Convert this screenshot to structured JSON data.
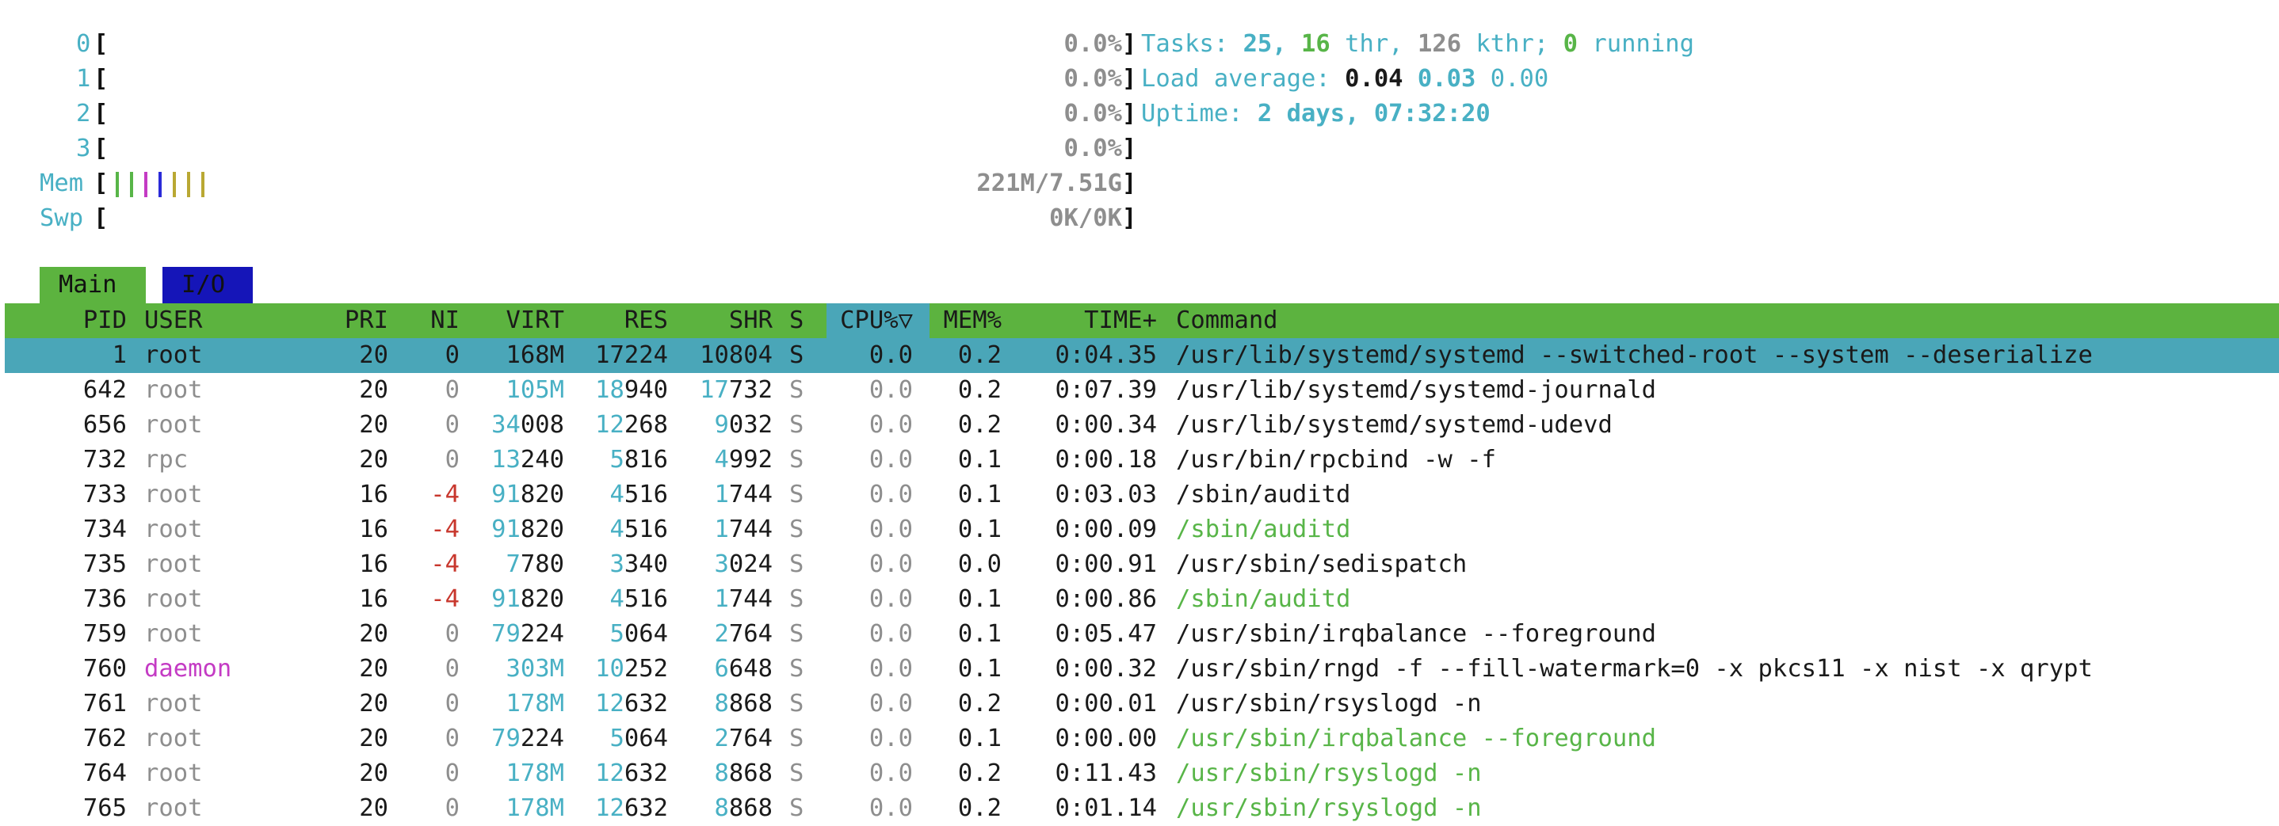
{
  "cpu_meters": [
    {
      "label": "0",
      "value": "0.0%"
    },
    {
      "label": "1",
      "value": "0.0%"
    },
    {
      "label": "2",
      "value": "0.0%"
    },
    {
      "label": "3",
      "value": "0.0%"
    }
  ],
  "mem": {
    "label": "Mem",
    "value": "221M/7.51G",
    "bar_colors": [
      "#58b548",
      "#58b548",
      "#c43bc4",
      "#2a2ad8",
      "#b9a833",
      "#b9a833",
      "#b9a833"
    ]
  },
  "swp": {
    "label": "Swp",
    "value": "0K/0K"
  },
  "summary": {
    "tasks_label": "Tasks:",
    "tasks": "25,",
    "thr": "16",
    "thr_label": "thr,",
    "kthr": "126",
    "kthr_label": "kthr;",
    "running": "0",
    "running_label": "running",
    "load_label": "Load average:",
    "load1": "0.04",
    "load5": "0.03",
    "load15": "0.00",
    "uptime_label": "Uptime:",
    "uptime": "2 days, 07:32:20"
  },
  "tabs": {
    "main": "Main",
    "io": "I/O"
  },
  "columns": {
    "pid": "PID",
    "user": "USER",
    "pri": "PRI",
    "ni": "NI",
    "virt": "VIRT",
    "res": "RES",
    "shr": "SHR",
    "s": "S",
    "cpu": "CPU%▽",
    "mem": "MEM%",
    "time": "TIME+",
    "command": "Command"
  },
  "processes": [
    {
      "pid": "1",
      "user": "root",
      "pri": "20",
      "ni": "0",
      "virt": "168M",
      "res": "17224",
      "shr": "10804",
      "s": "S",
      "cpu": "0.0",
      "mem": "0.2",
      "time": "0:04.35",
      "command": "/usr/lib/systemd/systemd --switched-root --system --deserialize",
      "selected": true
    },
    {
      "pid": "642",
      "user": "root",
      "pri": "20",
      "ni": "0",
      "virt": "105M",
      "res": "18940",
      "shr": "17732",
      "s": "S",
      "cpu": "0.0",
      "mem": "0.2",
      "time": "0:07.39",
      "command": "/usr/lib/systemd/systemd-journald"
    },
    {
      "pid": "656",
      "user": "root",
      "pri": "20",
      "ni": "0",
      "virt": "34008",
      "res": "12268",
      "shr": "9032",
      "s": "S",
      "cpu": "0.0",
      "mem": "0.2",
      "time": "0:00.34",
      "command": "/usr/lib/systemd/systemd-udevd"
    },
    {
      "pid": "732",
      "user": "rpc",
      "pri": "20",
      "ni": "0",
      "virt": "13240",
      "res": "5816",
      "shr": "4992",
      "s": "S",
      "cpu": "0.0",
      "mem": "0.1",
      "time": "0:00.18",
      "command": "/usr/bin/rpcbind -w -f"
    },
    {
      "pid": "733",
      "user": "root",
      "pri": "16",
      "ni": "-4",
      "virt": "91820",
      "res": "4516",
      "shr": "1744",
      "s": "S",
      "cpu": "0.0",
      "mem": "0.1",
      "time": "0:03.03",
      "command": "/sbin/auditd"
    },
    {
      "pid": "734",
      "user": "root",
      "pri": "16",
      "ni": "-4",
      "virt": "91820",
      "res": "4516",
      "shr": "1744",
      "s": "S",
      "cpu": "0.0",
      "mem": "0.1",
      "time": "0:00.09",
      "command": "/sbin/auditd",
      "thread": true
    },
    {
      "pid": "735",
      "user": "root",
      "pri": "16",
      "ni": "-4",
      "virt": "7780",
      "res": "3340",
      "shr": "3024",
      "s": "S",
      "cpu": "0.0",
      "mem": "0.0",
      "time": "0:00.91",
      "command": "/usr/sbin/sedispatch"
    },
    {
      "pid": "736",
      "user": "root",
      "pri": "16",
      "ni": "-4",
      "virt": "91820",
      "res": "4516",
      "shr": "1744",
      "s": "S",
      "cpu": "0.0",
      "mem": "0.1",
      "time": "0:00.86",
      "command": "/sbin/auditd",
      "thread": true
    },
    {
      "pid": "759",
      "user": "root",
      "pri": "20",
      "ni": "0",
      "virt": "79224",
      "res": "5064",
      "shr": "2764",
      "s": "S",
      "cpu": "0.0",
      "mem": "0.1",
      "time": "0:05.47",
      "command": "/usr/sbin/irqbalance --foreground"
    },
    {
      "pid": "760",
      "user": "daemon",
      "pri": "20",
      "ni": "0",
      "virt": "303M",
      "res": "10252",
      "shr": "6648",
      "s": "S",
      "cpu": "0.0",
      "mem": "0.1",
      "time": "0:00.32",
      "command": "/usr/sbin/rngd -f --fill-watermark=0 -x pkcs11 -x nist -x qrypt"
    },
    {
      "pid": "761",
      "user": "root",
      "pri": "20",
      "ni": "0",
      "virt": "178M",
      "res": "12632",
      "shr": "8868",
      "s": "S",
      "cpu": "0.0",
      "mem": "0.2",
      "time": "0:00.01",
      "command": "/usr/sbin/rsyslogd -n"
    },
    {
      "pid": "762",
      "user": "root",
      "pri": "20",
      "ni": "0",
      "virt": "79224",
      "res": "5064",
      "shr": "2764",
      "s": "S",
      "cpu": "0.0",
      "mem": "0.1",
      "time": "0:00.00",
      "command": "/usr/sbin/irqbalance --foreground",
      "thread": true
    },
    {
      "pid": "764",
      "user": "root",
      "pri": "20",
      "ni": "0",
      "virt": "178M",
      "res": "12632",
      "shr": "8868",
      "s": "S",
      "cpu": "0.0",
      "mem": "0.2",
      "time": "0:11.43",
      "command": "/usr/sbin/rsyslogd -n",
      "thread": true
    },
    {
      "pid": "765",
      "user": "root",
      "pri": "20",
      "ni": "0",
      "virt": "178M",
      "res": "12632",
      "shr": "8868",
      "s": "S",
      "cpu": "0.0",
      "mem": "0.2",
      "time": "0:01.14",
      "command": "/usr/sbin/rsyslogd -n",
      "thread": true
    }
  ]
}
